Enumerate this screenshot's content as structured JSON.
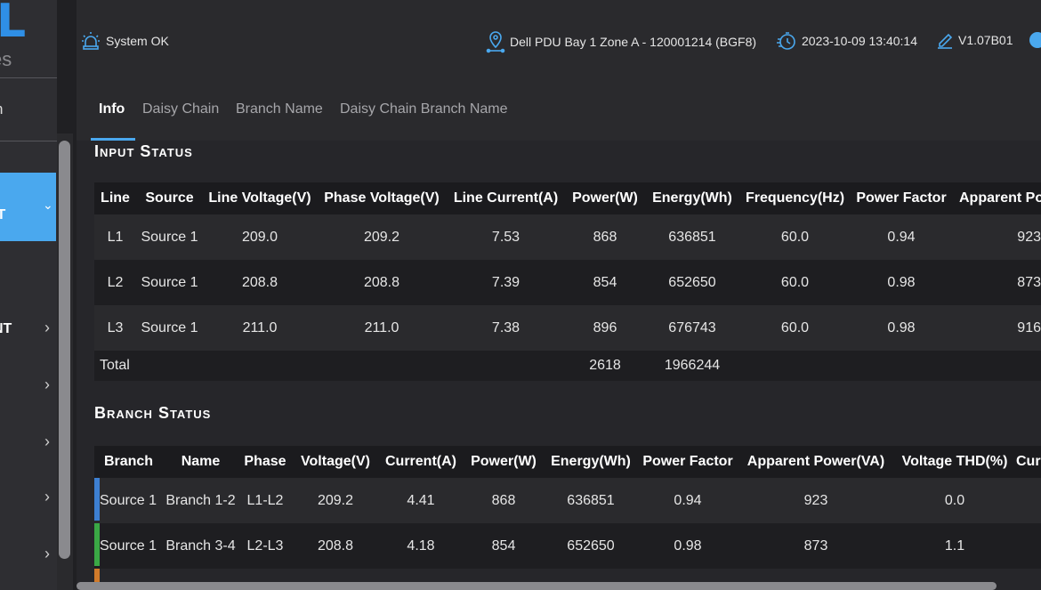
{
  "sidebar": {
    "logo_letter": "L",
    "logo_sub": "es",
    "item_partial": "n",
    "active_item_partial": "IT",
    "item2_partial": "NT"
  },
  "topbar": {
    "status": "System OK",
    "location": "Dell PDU Bay 1 Zone A - 120001214 (BGF8)",
    "datetime": "2023-10-09 13:40:14",
    "version": "V1.07B01"
  },
  "tabs": [
    "Info",
    "Daisy Chain",
    "Branch Name",
    "Daisy Chain Branch Name"
  ],
  "input_status": {
    "title": "Input Status",
    "headers": [
      "Line",
      "Source",
      "Line Voltage(V)",
      "Phase Voltage(V)",
      "Line Current(A)",
      "Power(W)",
      "Energy(Wh)",
      "Frequency(Hz)",
      "Power Factor",
      "Apparent Po"
    ],
    "rows": [
      [
        "L1",
        "Source 1",
        "209.0",
        "209.2",
        "7.53",
        "868",
        "636851",
        "60.0",
        "0.94",
        "923"
      ],
      [
        "L2",
        "Source 1",
        "208.8",
        "208.8",
        "7.39",
        "854",
        "652650",
        "60.0",
        "0.98",
        "873"
      ],
      [
        "L3",
        "Source 1",
        "211.0",
        "211.0",
        "7.38",
        "896",
        "676743",
        "60.0",
        "0.98",
        "916"
      ]
    ],
    "total_label": "Total",
    "total_power": "2618",
    "total_energy": "1966244"
  },
  "branch_status": {
    "title": "Branch Status",
    "headers": [
      "Branch",
      "Name",
      "Phase",
      "Voltage(V)",
      "Current(A)",
      "Power(W)",
      "Energy(Wh)",
      "Power Factor",
      "Apparent Power(VA)",
      "Voltage THD(%)",
      "Cur"
    ],
    "rows": [
      [
        "Source 1",
        "Branch 1-2",
        "L1-L2",
        "209.2",
        "4.41",
        "868",
        "636851",
        "0.94",
        "923",
        "0.0"
      ],
      [
        "Source 1",
        "Branch 3-4",
        "L2-L3",
        "208.8",
        "4.18",
        "854",
        "652650",
        "0.98",
        "873",
        "1.1"
      ]
    ],
    "marker_colors": [
      "#3d7fd1",
      "#3aa845",
      "#d07a2a"
    ]
  }
}
